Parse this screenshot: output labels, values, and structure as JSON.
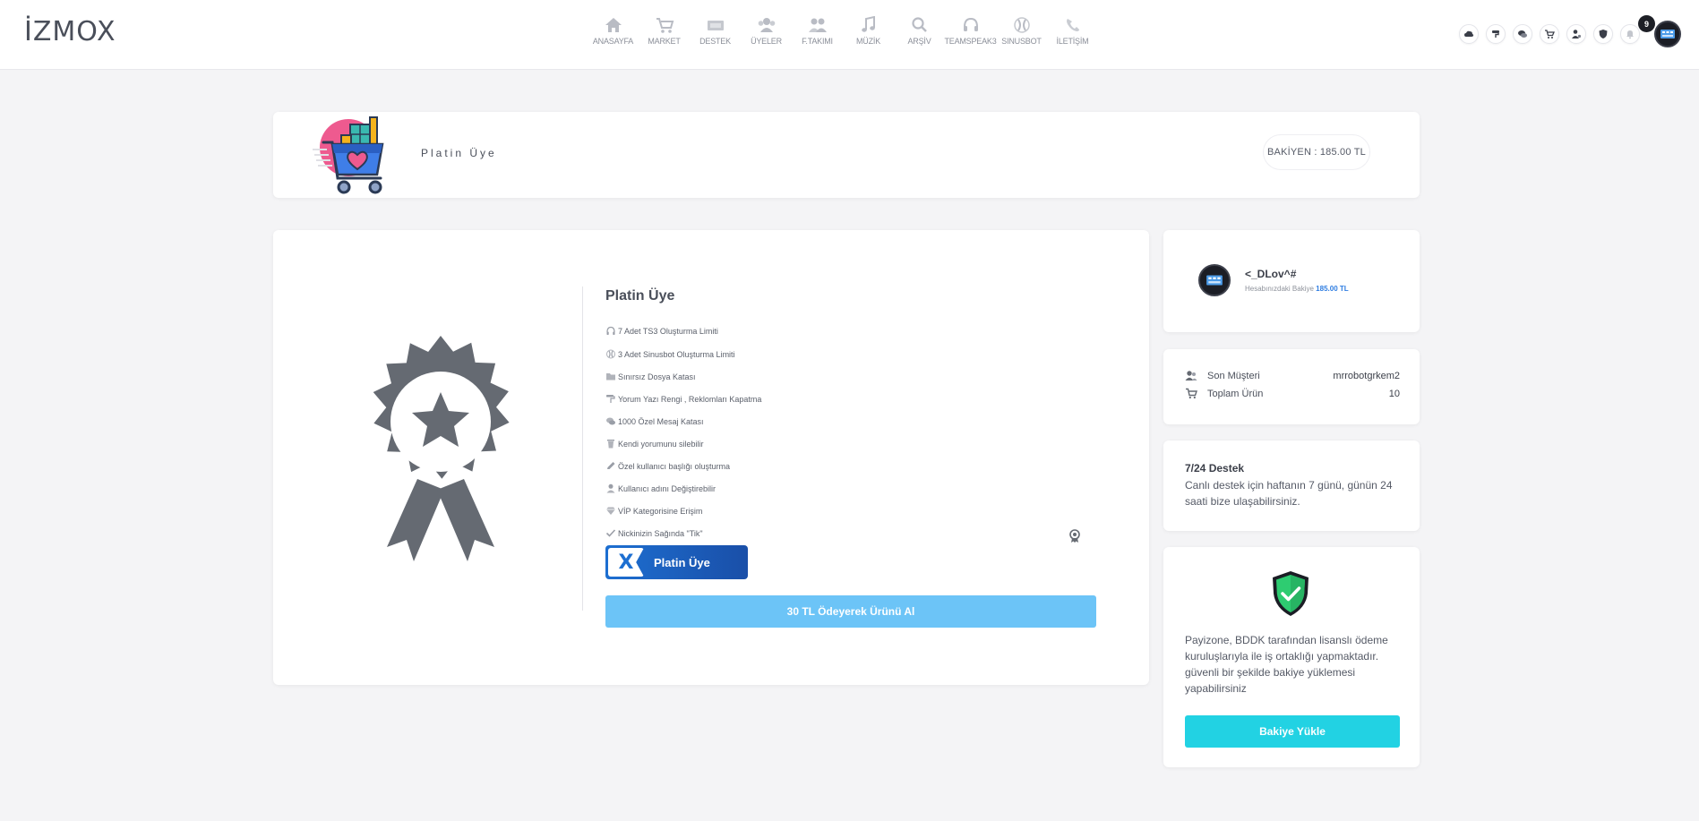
{
  "brand": {
    "logo_text": "İZMOX"
  },
  "nav": {
    "items": [
      {
        "label": "ANASAYFA",
        "icon": "home-icon"
      },
      {
        "label": "MARKET",
        "icon": "cart-icon"
      },
      {
        "label": "DESTEK",
        "icon": "ticket-icon"
      },
      {
        "label": "ÜYELER",
        "icon": "users-icon"
      },
      {
        "label": "F.TAKIMI",
        "icon": "team-icon"
      },
      {
        "label": "MÜZİK",
        "icon": "music-icon"
      },
      {
        "label": "ARŞİV",
        "icon": "search-icon"
      },
      {
        "label": "TEAMSPEAK3",
        "icon": "headset-icon"
      },
      {
        "label": "SINUSBOT",
        "icon": "bot-icon"
      },
      {
        "label": "İLETİŞİM",
        "icon": "phone-icon"
      }
    ],
    "right_icons": [
      "cloud-icon",
      "brush-icon",
      "chat-icon",
      "cart-icon",
      "user-settings-icon",
      "shield-icon",
      "bell-icon"
    ],
    "notification_count": "9"
  },
  "header": {
    "title": "Platin Üye",
    "balance": "BAKİYEN : 185.00 TL"
  },
  "product": {
    "title": "Platin Üye",
    "features": [
      {
        "text": "7 Adet TS3 Oluşturma Limiti",
        "icon": "headset-icon"
      },
      {
        "text": "3 Adet Sinusbot Oluşturma Limiti",
        "icon": "bot-icon"
      },
      {
        "text": "Sınırsız Dosya Katası",
        "icon": "folder-icon"
      },
      {
        "text": "Yorum Yazı Rengi , Reklomları Kapatma",
        "icon": "brush-icon"
      },
      {
        "text": "1000 Özel Mesaj Katası",
        "icon": "chat-icon"
      },
      {
        "text": "Kendi yorumunu silebilir",
        "icon": "trash-icon"
      },
      {
        "text": "Özel kullanıcı başlığı oluşturma",
        "icon": "pencil-icon"
      },
      {
        "text": "Kullanıcı adını Değiştirebilir",
        "icon": "user-icon"
      },
      {
        "text": "VİP Kategorisine Erişim",
        "icon": "diamond-icon"
      },
      {
        "text": "Nickinizin Sağında \"Tik\"",
        "icon": "check-icon"
      }
    ],
    "banner_label": "Platin Üye",
    "buy_button": "30 TL Ödeyerek Ürünü Al"
  },
  "user": {
    "name": "<_DLov^#",
    "balance_label": "Hesabınızdaki Bakiye",
    "balance_value": "185.00 TL"
  },
  "stats": {
    "last_customer_label": "Son Müşteri",
    "last_customer_value": "mrrobotgrkem2",
    "total_products_label": "Toplam Ürün",
    "total_products_value": "10"
  },
  "support": {
    "title": "7/24 Destek",
    "text": "Canlı destek için haftanın 7 günü, günün 24 saati bize ulaşabilirsiniz."
  },
  "payment": {
    "text": "Payizone, BDDK tarafından lisanslı ödeme kuruluşlarıyla ile iş ortaklığı yapmaktadır. güvenli bir şekilde bakiye yüklemesi yapabilirsiniz",
    "button": "Bakiye Yükle"
  },
  "colors": {
    "buy_button": "#6cc4f7",
    "topup_button": "#22d2e3",
    "banner": "#1d6fd1",
    "shield": "#2ecc71",
    "balance_accent": "#2f7de1"
  }
}
